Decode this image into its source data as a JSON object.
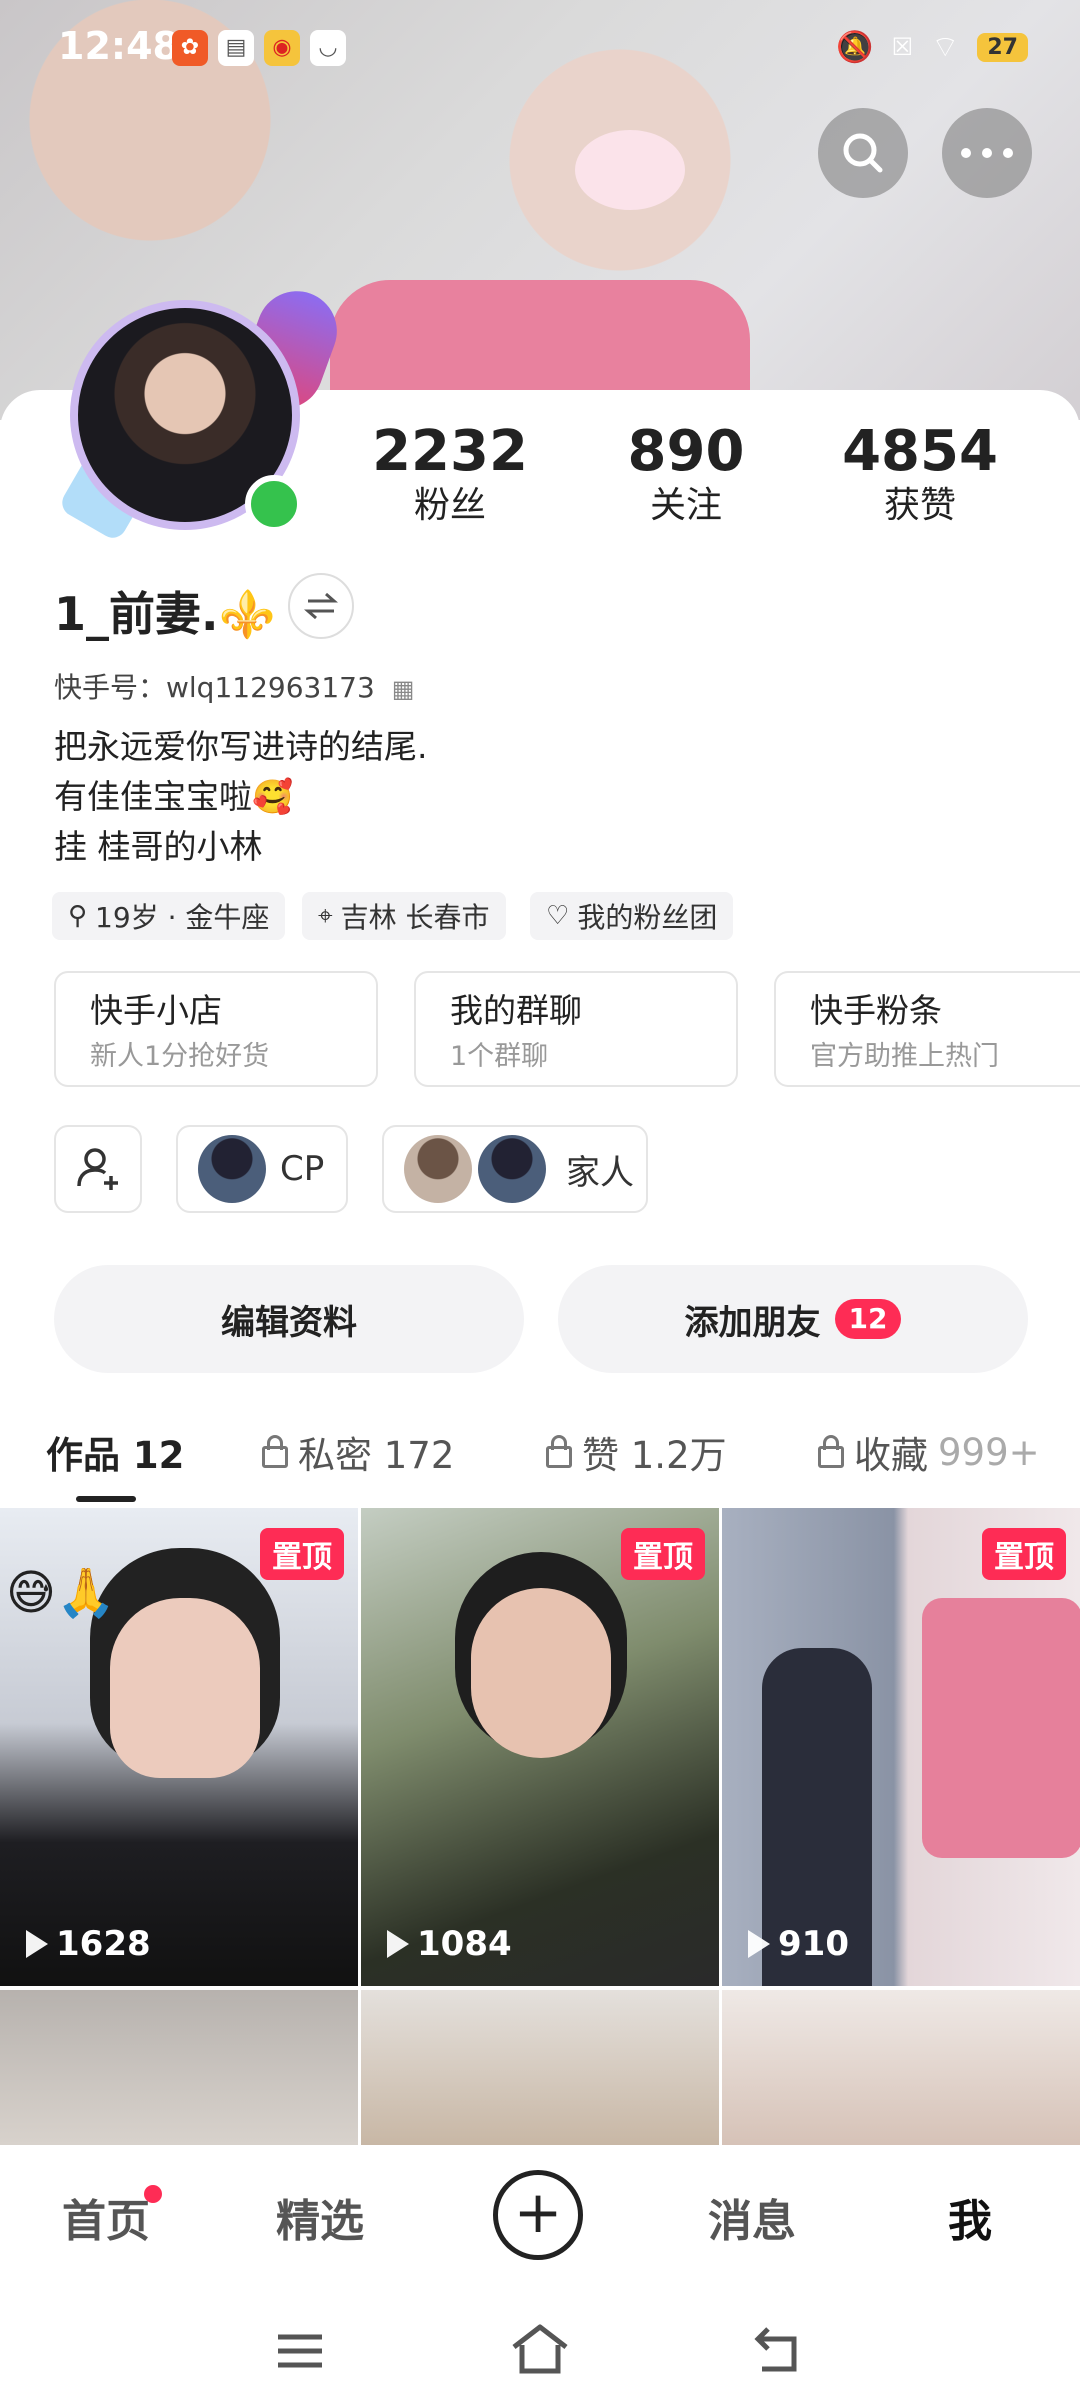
{
  "status_bar": {
    "time": "12:48",
    "battery": "27",
    "icons": [
      "kuaishou-icon",
      "bus-card-icon",
      "weibo-icon",
      "message-icon",
      "mute-icon",
      "sim-off-icon",
      "wifi-icon"
    ]
  },
  "profile": {
    "stats": [
      {
        "value": "2232",
        "label": "粉丝"
      },
      {
        "value": "890",
        "label": "关注"
      },
      {
        "value": "4854",
        "label": "获赞"
      }
    ],
    "nickname": "1_前妻.⚜️",
    "kuaishou_id": "快手号：wlq112963173",
    "bio": [
      "把永远爱你写进诗的结尾.",
      "有佳佳宝宝啦🥰",
      "挂  桂哥的小林"
    ],
    "tags": [
      {
        "icon": "gender-icon",
        "label": "19岁 · 金牛座"
      },
      {
        "icon": "location-icon",
        "label": "吉林 长春市"
      },
      {
        "icon": "heart-icon",
        "label": "我的粉丝团"
      }
    ]
  },
  "services": [
    {
      "title": "快手小店",
      "subtitle": "新人1分抢好货"
    },
    {
      "title": "我的群聊",
      "subtitle": "1个群聊"
    },
    {
      "title": "快手粉条",
      "subtitle": "官方助推上热门"
    }
  ],
  "relations": [
    {
      "label": "CP"
    },
    {
      "label": "家人"
    }
  ],
  "actions": {
    "edit_profile": "编辑资料",
    "add_friend": "添加朋友",
    "add_friend_badge": "12"
  },
  "tabs": [
    {
      "label": "作品 12",
      "locked": false
    },
    {
      "label": "私密 172",
      "locked": true
    },
    {
      "label": "赞 1.2万",
      "locked": true
    },
    {
      "label": "收藏",
      "extra": "999+",
      "locked": true
    }
  ],
  "videos": [
    {
      "pinned": true,
      "pin_label": "置顶",
      "plays": "1628",
      "emoji": "😅🙏"
    },
    {
      "pinned": true,
      "pin_label": "置顶",
      "plays": "1084"
    },
    {
      "pinned": true,
      "pin_label": "置顶",
      "plays": "910"
    }
  ],
  "bottom_nav": [
    {
      "label": "首页",
      "has_dot": true
    },
    {
      "label": "精选"
    },
    {
      "label": "消息"
    },
    {
      "label": "我",
      "active": true
    }
  ],
  "colors": {
    "accent": "#fe2c55",
    "online": "#35c24d"
  }
}
